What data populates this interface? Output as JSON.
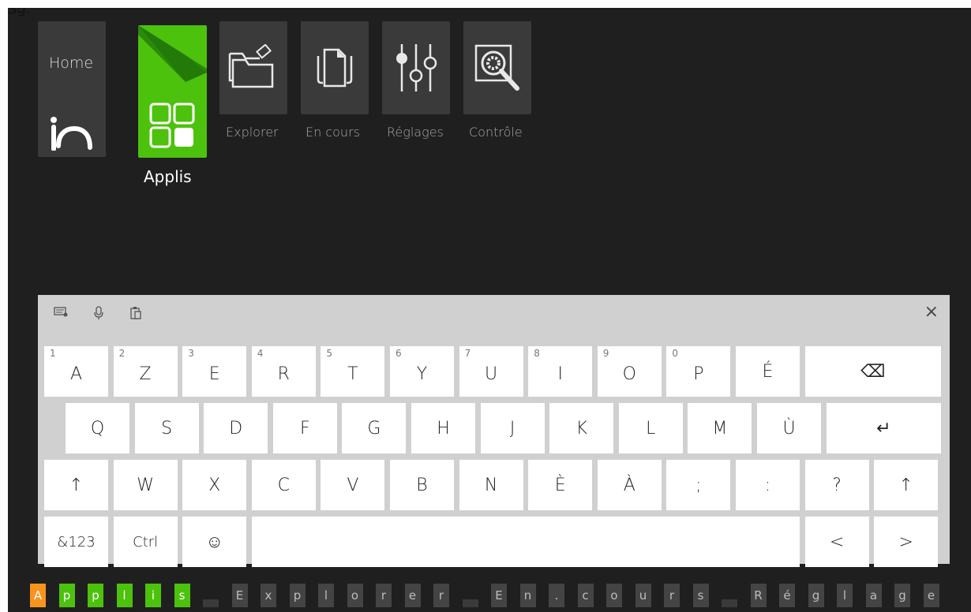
{
  "top_fragment": "Sg:",
  "tiles": {
    "home": {
      "label": "Home"
    },
    "apps": {
      "label": "Applis",
      "accent": "#4cc20c"
    },
    "explorer": {
      "label": "Explorer"
    },
    "current": {
      "label": "En cours"
    },
    "settings": {
      "label": "Réglages"
    },
    "control": {
      "label": "Contrôle"
    }
  },
  "keyboard": {
    "toolbar": [
      "keyboard-settings-icon",
      "microphone-icon",
      "clipboard-icon"
    ],
    "close_label": "×",
    "rows": [
      [
        {
          "main": "A",
          "hint": "1"
        },
        {
          "main": "Z",
          "hint": "2"
        },
        {
          "main": "E",
          "hint": "3"
        },
        {
          "main": "R",
          "hint": "4"
        },
        {
          "main": "T",
          "hint": "5"
        },
        {
          "main": "Y",
          "hint": "6"
        },
        {
          "main": "U",
          "hint": "7"
        },
        {
          "main": "I",
          "hint": "8"
        },
        {
          "main": "O",
          "hint": "9"
        },
        {
          "main": "P",
          "hint": "0"
        },
        {
          "main": "É",
          "hint": ""
        },
        {
          "main": "⌫",
          "hint": ""
        }
      ],
      [
        {
          "main": "Q"
        },
        {
          "main": "S"
        },
        {
          "main": "D"
        },
        {
          "main": "F"
        },
        {
          "main": "G"
        },
        {
          "main": "H"
        },
        {
          "main": "J"
        },
        {
          "main": "K"
        },
        {
          "main": "L"
        },
        {
          "main": "M"
        },
        {
          "main": "Ù"
        },
        {
          "main": "↵"
        }
      ],
      [
        {
          "main": "↑"
        },
        {
          "main": "W"
        },
        {
          "main": "X"
        },
        {
          "main": "C"
        },
        {
          "main": "V"
        },
        {
          "main": "B"
        },
        {
          "main": "N"
        },
        {
          "main": "È"
        },
        {
          "main": "À"
        },
        {
          "main": ";"
        },
        {
          "main": ":"
        },
        {
          "main": "?"
        },
        {
          "main": "↑"
        }
      ],
      [
        {
          "main": "&123"
        },
        {
          "main": "Ctrl"
        },
        {
          "main": "☺"
        },
        {
          "main": ""
        },
        {
          "main": "<"
        },
        {
          "main": ">"
        }
      ]
    ]
  },
  "strip": {
    "chars": [
      "A",
      "p",
      "p",
      "l",
      "i",
      "s",
      " ",
      "E",
      "x",
      "p",
      "l",
      "o",
      "r",
      "e",
      "r",
      " ",
      "E",
      "n",
      ".",
      "c",
      "o",
      "u",
      "r",
      "s",
      " ",
      "R",
      "é",
      "g",
      "l",
      "a",
      "g",
      "e"
    ],
    "colors": {
      "first": "#f7941d",
      "match": "#4cc20c",
      "dim": "#444444",
      "space": "#3a3a3a"
    },
    "match_count": 6
  }
}
